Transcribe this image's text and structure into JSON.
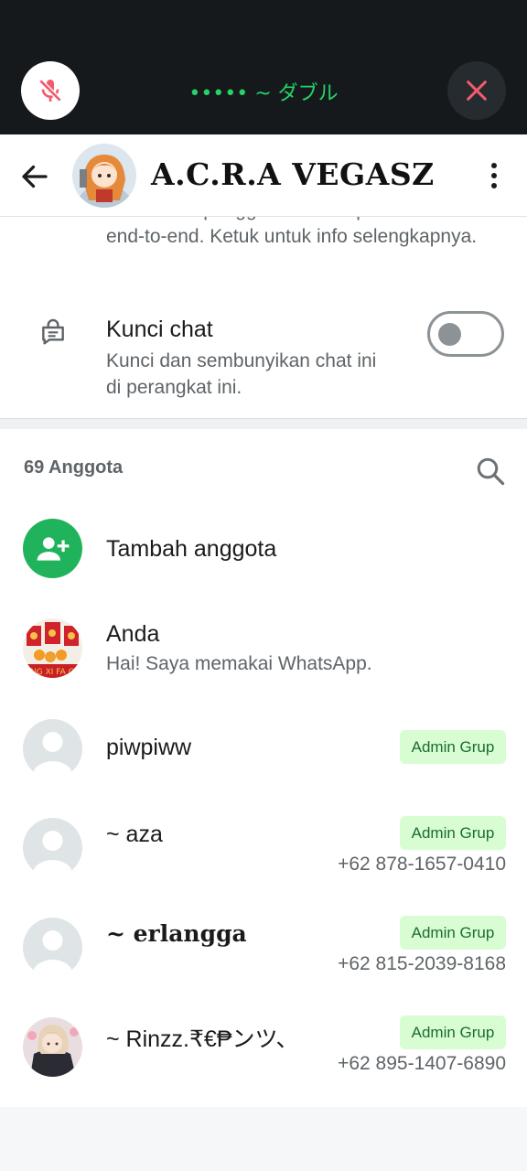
{
  "call": {
    "title": "•••••  ~ ダブル"
  },
  "header": {
    "group_name": "A.C.R.A VEGASZ"
  },
  "encryption": {
    "text": "Pesan dan panggilan terenkripsi secara end-to-end. Ketuk untuk info selengkapnya."
  },
  "chat_lock": {
    "title": "Kunci chat",
    "description": "Kunci dan sembunyikan chat ini di perangkat ini.",
    "enabled": false
  },
  "members": {
    "count_label": "69 Anggota",
    "add_label": "Tambah anggota",
    "list": [
      {
        "name": "Anda",
        "status": "Hai! Saya memakai WhatsApp.",
        "badge": "",
        "phone": ""
      },
      {
        "name": "piwpiww",
        "status": "",
        "badge": "Admin Grup",
        "phone": ""
      },
      {
        "name": "~ aza",
        "status": "",
        "badge": "Admin Grup",
        "phone": "+62 878-1657-0410"
      },
      {
        "name": "~ erlangga",
        "status": "",
        "badge": "Admin Grup",
        "phone": "+62 815-2039-8168"
      },
      {
        "name": "~ Rinzz.₹€₱ンツ、",
        "status": "",
        "badge": "Admin Grup",
        "phone": "+62 895-1407-6890"
      }
    ]
  },
  "colors": {
    "accent": "#25d366",
    "add_button": "#21b35c",
    "badge_bg": "#d9fdd3",
    "badge_text": "#1a6b36",
    "close_icon": "#f15c6d"
  }
}
